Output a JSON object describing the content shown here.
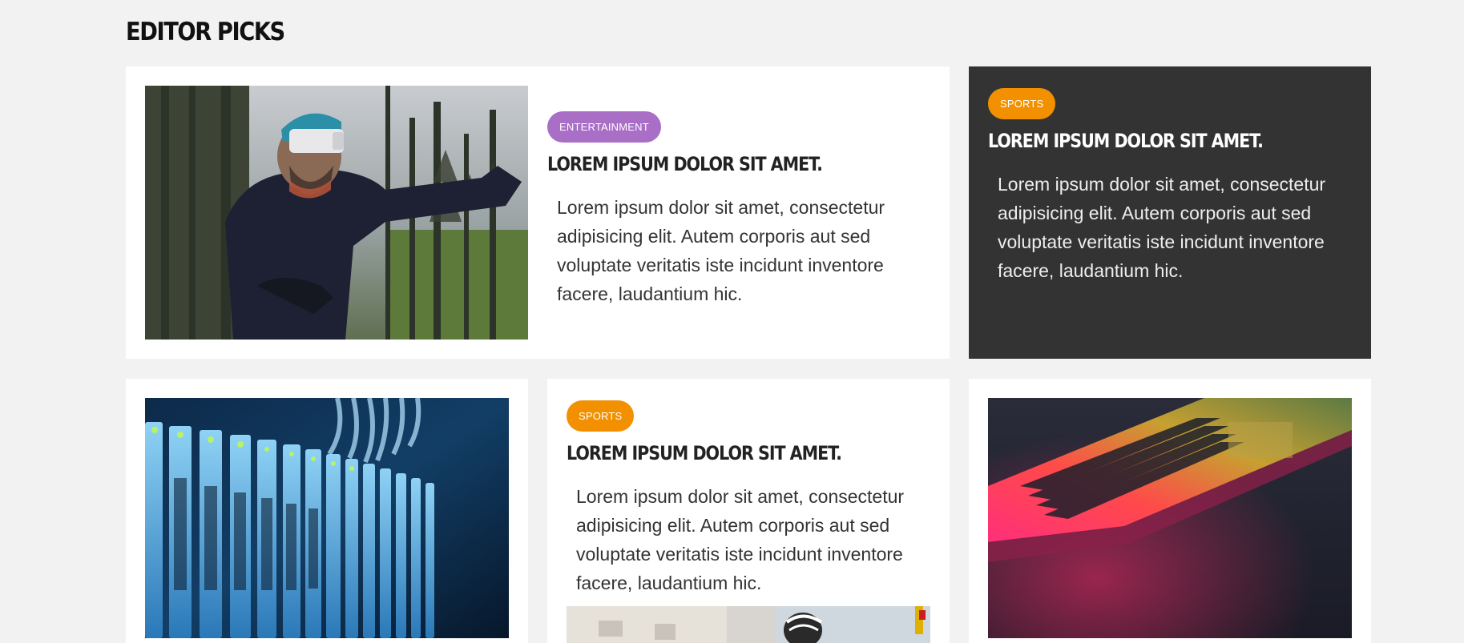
{
  "section": {
    "title": "EDITOR PICKS"
  },
  "cards": [
    {
      "category": "ENTERTAINMENT",
      "category_color": "#a96fc7",
      "headline": "LOREM IPSUM DOLOR SIT AMET.",
      "excerpt": "Lorem ipsum dolor sit amet, consectetur adipisicing elit. Autem corporis aut sed voluptate veritatis iste incidunt inventore facere, laudantium hic.",
      "image": "vr-headset-forest-photo"
    },
    {
      "category": "SPORTS",
      "category_color": "#f29000",
      "headline": "LOREM IPSUM DOLOR SIT AMET.",
      "excerpt": "Lorem ipsum dolor sit amet, consectetur adipisicing elit. Autem corporis aut sed voluptate veritatis iste incidunt inventore facere, laudantium hic.",
      "background": "#333333"
    },
    {
      "image": "server-rack-photo"
    },
    {
      "category": "SPORTS",
      "category_color": "#f29000",
      "headline": "LOREM IPSUM DOLOR SIT AMET.",
      "excerpt": "Lorem ipsum dolor sit amet, consectetur adipisicing elit. Autem corporis aut sed voluptate veritatis iste incidunt inventore facere, laudantium hic.",
      "image": "cyclist-photo"
    },
    {
      "image": "rgb-laptop-keyboard-photo"
    }
  ]
}
